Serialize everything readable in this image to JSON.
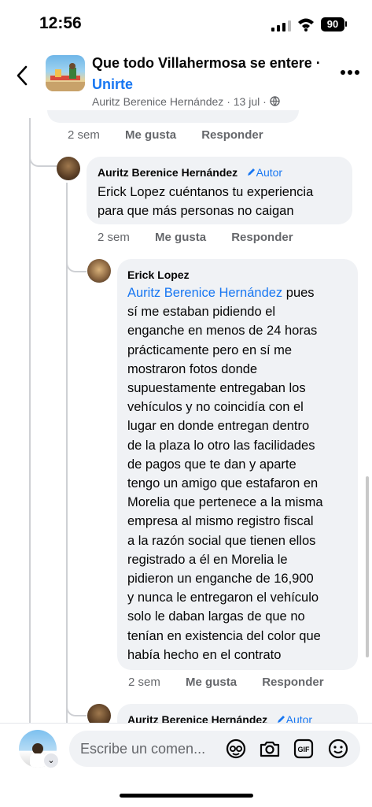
{
  "status_bar": {
    "time": "12:56",
    "battery": "90"
  },
  "header": {
    "group_name": "Que todo Villahermosa se entere ·",
    "join_label": "Unirte",
    "post_author": "Auritz Berenice Hernández",
    "post_date": "· 13 jul ·"
  },
  "comments": [
    {
      "time": "2 sem",
      "like_label": "Me gusta",
      "reply_label": "Responder"
    },
    {
      "name": "Auritz Berenice Hernández",
      "badge": "Autor",
      "lines": [
        "Erick Lopez cuéntanos tu experiencia",
        "para que más personas no caigan"
      ],
      "time": "2 sem",
      "like_label": "Me gusta",
      "reply_label": "Responder"
    },
    {
      "name": "Erick Lopez",
      "mention": "Auritz Berenice Hernández",
      "first_line_rest": " pues",
      "lines": [
        "sí me estaban pidiendo el",
        "enganche en menos de 24 horas",
        "prácticamente pero en sí me",
        "mostraron fotos donde",
        "supuestamente entregaban los",
        "vehículos y no coincidía con el",
        "lugar en donde entregan dentro",
        "de la plaza lo otro las facilidades",
        "de pagos que te dan y aparte",
        "tengo un amigo que estafaron en",
        "Morelia que pertenece a la misma",
        "empresa al mismo registro fiscal",
        "a la razón social que tienen ellos",
        "registrado a él en Morelia le",
        "pidieron un enganche de 16,900",
        "y nunca le entregaron el vehículo",
        "solo le daban largas de que no",
        "tenían en existencia del color que",
        "había hecho en el contrato"
      ],
      "time": "2 sem",
      "like_label": "Me gusta",
      "reply_label": "Responder"
    },
    {
      "name": "Auritz Berenice Hernández",
      "badge": "Autor"
    }
  ],
  "composer": {
    "placeholder": "Escribe un comen...",
    "icons": [
      "avatar-sticker-icon",
      "camera-icon",
      "gif-icon",
      "emoji-icon"
    ]
  }
}
